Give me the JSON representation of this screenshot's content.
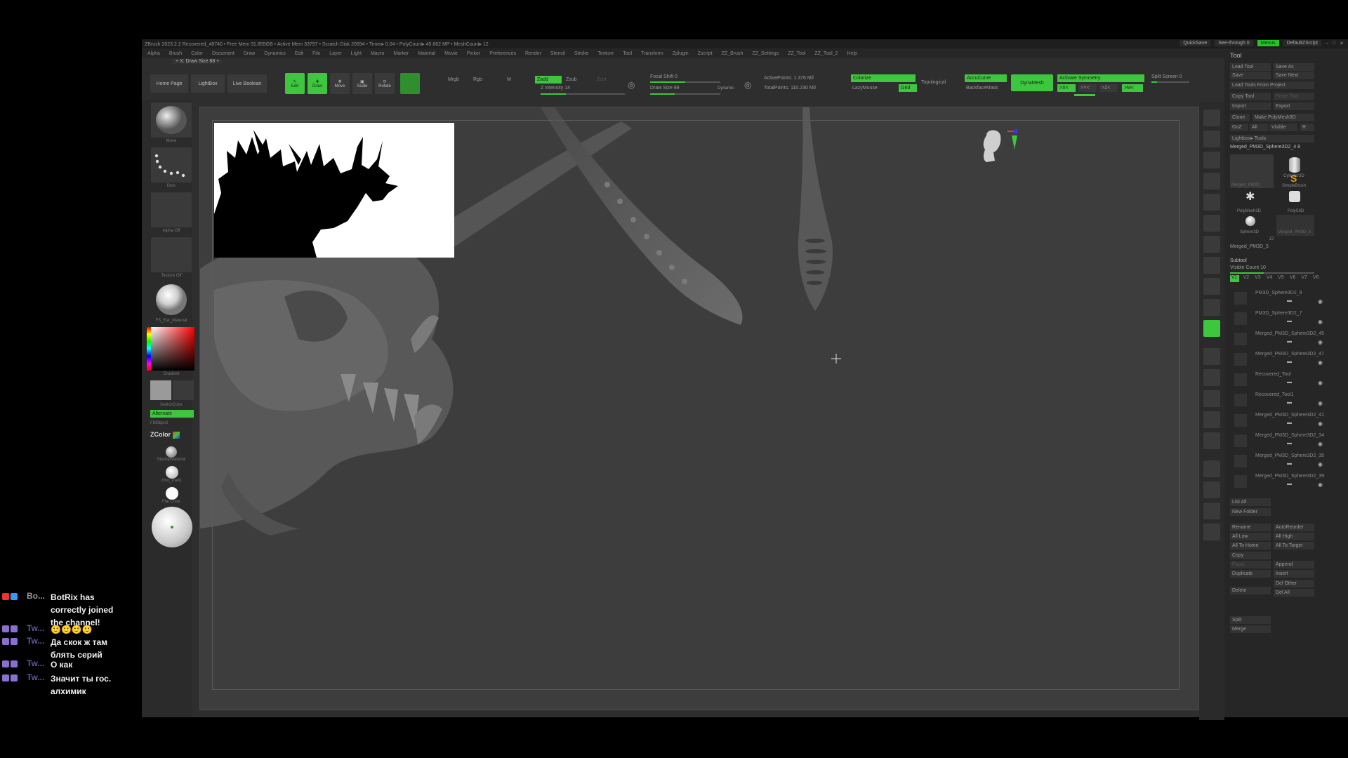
{
  "window": {
    "title": "ZBrush 2023.2.2   Recovered_48740   • Free Mem 31.855GB • Active Mem 33797 • Scratch Disk 20594 • Timer▸ 0.04 • PolyCount▸ 45.862 MP • MeshCount▸ 12",
    "quicksave": "QuickSave",
    "see_through": "See-through  0",
    "menus_btn": "Menus",
    "default_script": "DefaultZScript"
  },
  "menu": [
    "Alpha",
    "Brush",
    "Color",
    "Document",
    "Draw",
    "Dynamics",
    "Edit",
    "File",
    "Layer",
    "Light",
    "Macro",
    "Marker",
    "Material",
    "Movie",
    "Picker",
    "Preferences",
    "Render",
    "Stencil",
    "Stroke",
    "Texture",
    "Tool",
    "Transform",
    "Zplugin",
    "Zscript",
    "ZZ_Brush",
    "ZZ_Settings",
    "ZZ_Tool",
    "ZZ_Tool_2",
    "Help"
  ],
  "draw_size_tip": "+ X: Draw Size  88 +",
  "toolbar": {
    "home_page": "Home Page",
    "lightbox": "LightBox",
    "live_boolean": "Live Boolean",
    "edit": "Edit",
    "draw": "Draw",
    "move": "Move",
    "scale": "Scale",
    "rotate": "Rotate",
    "mrgb": "Mrgb",
    "rgb": "Rgb",
    "m": "M",
    "zadd": "Zadd",
    "zsub": "Zsub",
    "zcut": "Zcut",
    "z_intensity": "Z Intensity  14",
    "focal_shift": "Focal Shift  0",
    "draw_size": "Draw Size  88",
    "dynamic": "Dynamic",
    "active_points": "ActivePoints: 1.376 Mil",
    "total_points": "TotalPoints: 110.230 Mil",
    "colorize": "Colorize",
    "lazymouse": "LazyMouse",
    "grid": "Grid",
    "topological": "Topological",
    "accucurve": "AccuCurve",
    "backface_mask": "BackfaceMask",
    "dynamesh": "DynaMesh",
    "activate_symmetry": "Activate Symmetry",
    "sym_x": ">X<",
    "sym_y": ">Y<",
    "sym_z": ">Z<",
    "sym_m": ">M<",
    "split_screen": "Split Screen  0"
  },
  "left_shelf": {
    "labels": [
      "Move",
      "Dots",
      "Alpha Off",
      "Texture Off",
      "FS_Ear_Material",
      "Gradient",
      "SwitchColor",
      "Alternate",
      "FillObject",
      "StartupMaterial",
      "zbro_Paint",
      "Flat Color"
    ],
    "zcolor": "ZColor"
  },
  "tool_panel": {
    "title": "Tool",
    "buttons": [
      "Load Tool",
      "Save As",
      "Save",
      "Save Next",
      "Load Tools From Project",
      "Copy Tool",
      "Paste Tool",
      "Import",
      "Export",
      "Clone",
      "Make PolyMesh3D",
      "GoZ",
      "All",
      "Visible",
      "R",
      "Lightbox▸ Tools"
    ],
    "current_tool": "Merged_PM3D_Sphere3D2_4  8",
    "tool_thumbs": [
      "Merged_PM3D_",
      "Cylinder3D",
      "SimpleBrush",
      "PolyMesh3D",
      "PolyS3D",
      "Sphere3D",
      "Merged_PM3D_5"
    ],
    "tool_count": "27",
    "subtool_header": "Subtool",
    "visible_count": "Visible Count  10",
    "versions": [
      "V1",
      "V2",
      "V3",
      "V4",
      "V5",
      "V6",
      "V7",
      "V8"
    ],
    "subtools": [
      "PM3D_Sphere3D2_9",
      "PM3D_Sphere3D2_7",
      "Merged_PM3D_Sphere3D2_45",
      "Merged_PM3D_Sphere3D2_47",
      "Recovered_Tool",
      "Recovered_Tool1",
      "Merged_PM3D_Sphere3D2_41",
      "Merged_PM3D_Sphere3D2_34",
      "Merged_PM3D_Sphere3D2_35",
      "Merged_PM3D_Sphere3D2_39"
    ],
    "list_all": "List All",
    "new_folder": "New Folder",
    "actions": [
      "Rename",
      "AutoReorder",
      "All Low",
      "All High",
      "All To Home",
      "All To Target",
      "Copy",
      "Paste",
      "Duplicate",
      "Append",
      "Insert",
      "Delete",
      "Del Other",
      "Del All",
      "Split",
      "Merge"
    ]
  },
  "chat": [
    {
      "user": "Bo...",
      "text": "BotRix has correctly joined the channel!"
    },
    {
      "user": "Tw...",
      "text": "🙂🙂🙂🙂"
    },
    {
      "user": "Tw...",
      "text": "Да скок ж там блять серий"
    },
    {
      "user": "Tw...",
      "text": "О как"
    },
    {
      "user": "Tw...",
      "text": "Значит ты гос. алхимик"
    }
  ],
  "colors": {
    "accent_green": "#3ec63e",
    "canvas_bg": "#3d3d3d",
    "panel_bg": "#262626"
  }
}
